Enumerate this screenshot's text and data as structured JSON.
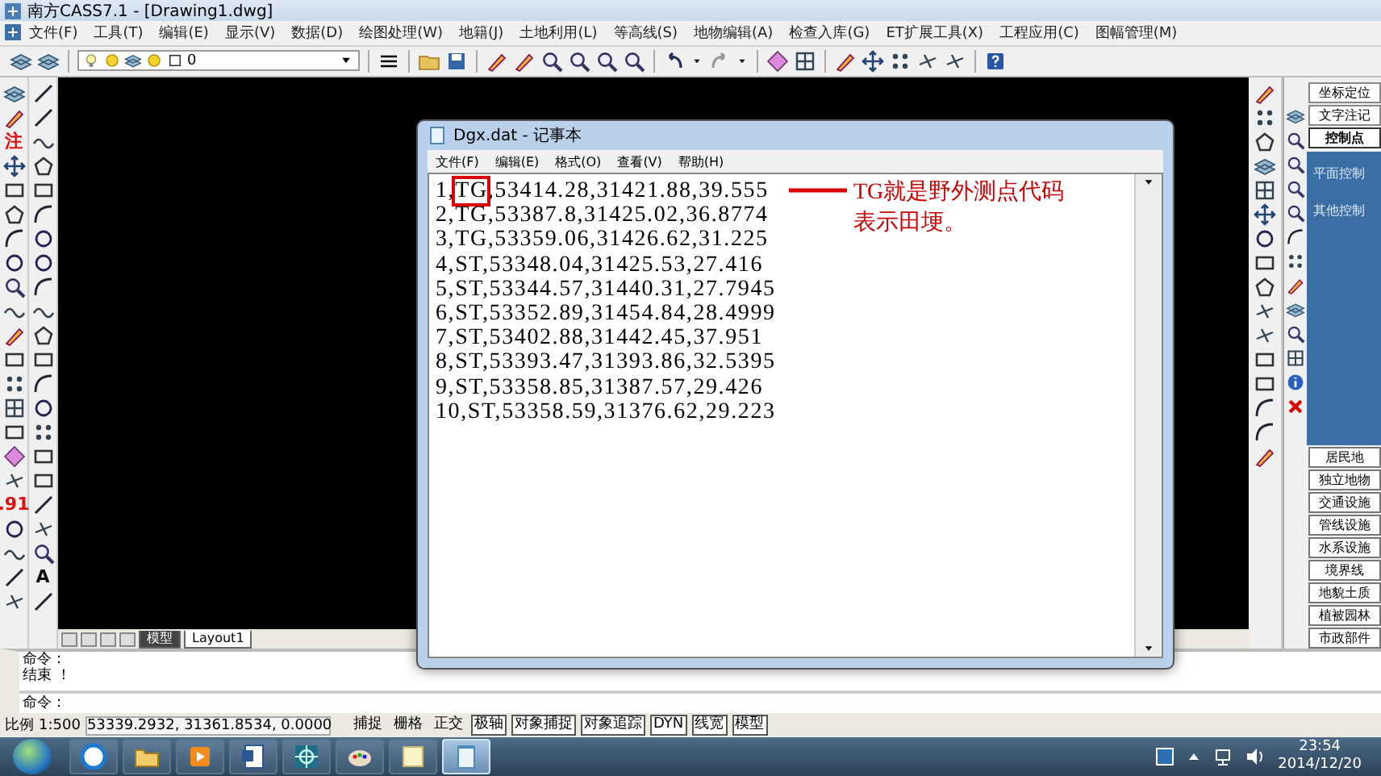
{
  "window": {
    "title": "南方CASS7.1 - [Drawing1.dwg]"
  },
  "menu": [
    "文件(F)",
    "工具(T)",
    "编辑(E)",
    "显示(V)",
    "数据(D)",
    "绘图处理(W)",
    "地籍(J)",
    "土地利用(L)",
    "等高线(S)",
    "地物编辑(A)",
    "检查入库(G)",
    "ET扩展工具(X)",
    "工程应用(C)",
    "图幅管理(M)"
  ],
  "toolbar": {
    "layer": "0"
  },
  "left_toolbar": {
    "glyphs": [
      "注",
      ".91",
      "A"
    ]
  },
  "layout_tabs": [
    {
      "label": "模型",
      "selected": true
    },
    {
      "label": "Layout1",
      "selected": false
    }
  ],
  "side_panel": {
    "categories": [
      {
        "label": "坐标定位",
        "selected": false
      },
      {
        "label": "文字注记",
        "selected": false
      },
      {
        "label": "控制点",
        "selected": true
      }
    ],
    "items": [
      "平面控制",
      "其他控制"
    ],
    "groups": [
      "居民地",
      "独立地物",
      "交通设施",
      "管线设施",
      "水系设施",
      "境界线",
      "地貌土质",
      "植被园林",
      "市政部件"
    ]
  },
  "notepad": {
    "title": "Dgx.dat - 记事本",
    "menu": [
      "文件(F)",
      "编辑(E)",
      "格式(O)",
      "查看(V)",
      "帮助(H)"
    ],
    "lines": [
      {
        "parts": [
          {
            "text": "1,",
            "boxed": false
          },
          {
            "text": "TG",
            "boxed": true
          },
          {
            "text": ",53414.28,31421.88,39.555",
            "boxed": false
          }
        ]
      },
      {
        "parts": [
          {
            "text": "2,TG,53387.8,31425.02,36.8774",
            "boxed": false
          }
        ]
      },
      {
        "parts": [
          {
            "text": "3,TG,53359.06,31426.62,31.225",
            "boxed": false
          }
        ]
      },
      {
        "parts": [
          {
            "text": "4,ST,53348.04,31425.53,27.416",
            "boxed": false
          }
        ]
      },
      {
        "parts": [
          {
            "text": "5,ST,53344.57,31440.31,27.7945",
            "boxed": false
          }
        ]
      },
      {
        "parts": [
          {
            "text": "6,ST,53352.89,31454.84,28.4999",
            "boxed": false
          }
        ]
      },
      {
        "parts": [
          {
            "text": "7,ST,53402.88,31442.45,37.951",
            "boxed": false
          }
        ]
      },
      {
        "parts": [
          {
            "text": "8,ST,53393.47,31393.86,32.5395",
            "boxed": false
          }
        ]
      },
      {
        "parts": [
          {
            "text": "9,ST,53358.85,31387.57,29.426",
            "boxed": false
          }
        ]
      },
      {
        "parts": [
          {
            "text": "10,ST,53358.59,31376.62,29.223",
            "boxed": false
          }
        ]
      }
    ],
    "annotation": {
      "lines": [
        "TG就是野外测点代码",
        "表示田埂。"
      ]
    }
  },
  "command": {
    "history": [
      "命令：",
      "结束 ！"
    ],
    "prompt": "命令："
  },
  "status_bar": {
    "scale_label": "比例",
    "scale": "1:500",
    "coordinates": "53339.2932, 31361.8534, 0.0000",
    "toggles": [
      {
        "label": "捕捉",
        "on": false
      },
      {
        "label": "栅格",
        "on": false
      },
      {
        "label": "正交",
        "on": false
      },
      {
        "label": "极轴",
        "on": true
      },
      {
        "label": "对象捕捉",
        "on": true
      },
      {
        "label": "对象追踪",
        "on": true
      },
      {
        "label": "DYN",
        "on": true
      },
      {
        "label": "线宽",
        "on": true
      },
      {
        "label": "模型",
        "on": true
      }
    ]
  },
  "taskbar": {
    "apps": [
      {
        "kind": "browser",
        "selected": false
      },
      {
        "kind": "folder",
        "selected": false
      },
      {
        "kind": "media",
        "selected": false
      },
      {
        "kind": "document",
        "selected": false
      },
      {
        "kind": "cad",
        "selected": false
      },
      {
        "kind": "paint",
        "selected": false
      },
      {
        "kind": "notes",
        "selected": false
      },
      {
        "kind": "notepad",
        "selected": true
      }
    ],
    "time": "23:54",
    "date": "2014/12/20"
  }
}
